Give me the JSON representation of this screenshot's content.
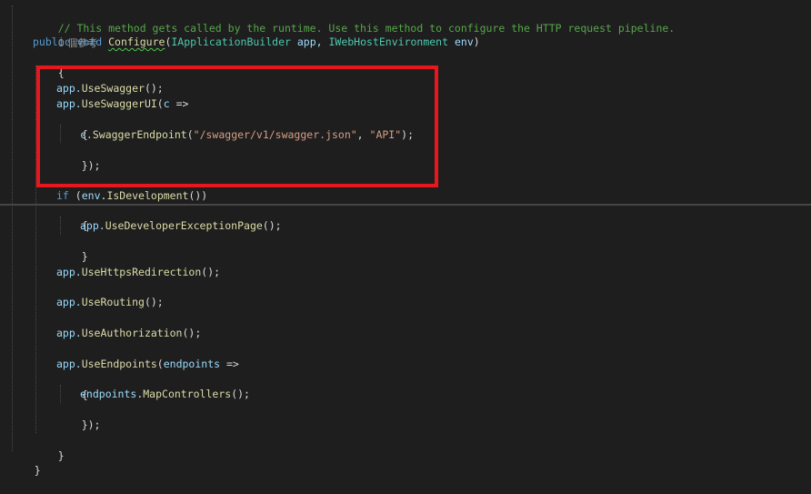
{
  "code": {
    "comment": "// This method gets called by the runtime. Use this method to configure the HTTP request pipeline.",
    "codelens": "0 個參考",
    "kw_public": "public",
    "kw_void": "void",
    "method_configure": "Configure",
    "sig_open": "(",
    "type_app_builder": "IApplicationBuilder",
    "sig_app": " app, ",
    "type_webhost_env": "IWebHostEnvironment",
    "sig_space": " ",
    "param_env": "env",
    "sig_close": ")",
    "brace_open": "{",
    "brace_close": "}",
    "app_prefix": "app.",
    "use_swagger": "UseSwagger",
    "call_end": "();",
    "use_swagger_ui": "UseSwaggerUI",
    "paren_open": "(",
    "lambda_c": "c",
    "arrow": " =>",
    "c_prefix": "c.",
    "swagger_endpoint": "SwaggerEndpoint",
    "endpoint_url": "\"/swagger/v1/swagger.json\"",
    "comma": ", ",
    "endpoint_name": "\"API\"",
    "close_call": ");",
    "close_lambda": "});",
    "kw_if": "if",
    "if_open": " (",
    "env_dot": ".",
    "is_development": "IsDevelopment",
    "if_close": "())",
    "use_dev_exception_page": "UseDeveloperExceptionPage",
    "use_https_redirection": "UseHttpsRedirection",
    "use_routing": "UseRouting",
    "use_authorization": "UseAuthorization",
    "use_endpoints": "UseEndpoints",
    "lambda_endpoints": "endpoints",
    "map_controllers": "MapControllers"
  },
  "colors": {
    "background": "#1e1e1e",
    "comment": "#57a64a",
    "keyword": "#569cd6",
    "type": "#4ec9b0",
    "method": "#dcdcaa",
    "parameter": "#9cdcfe",
    "string": "#d69d85",
    "highlight_box": "#e8161d"
  }
}
